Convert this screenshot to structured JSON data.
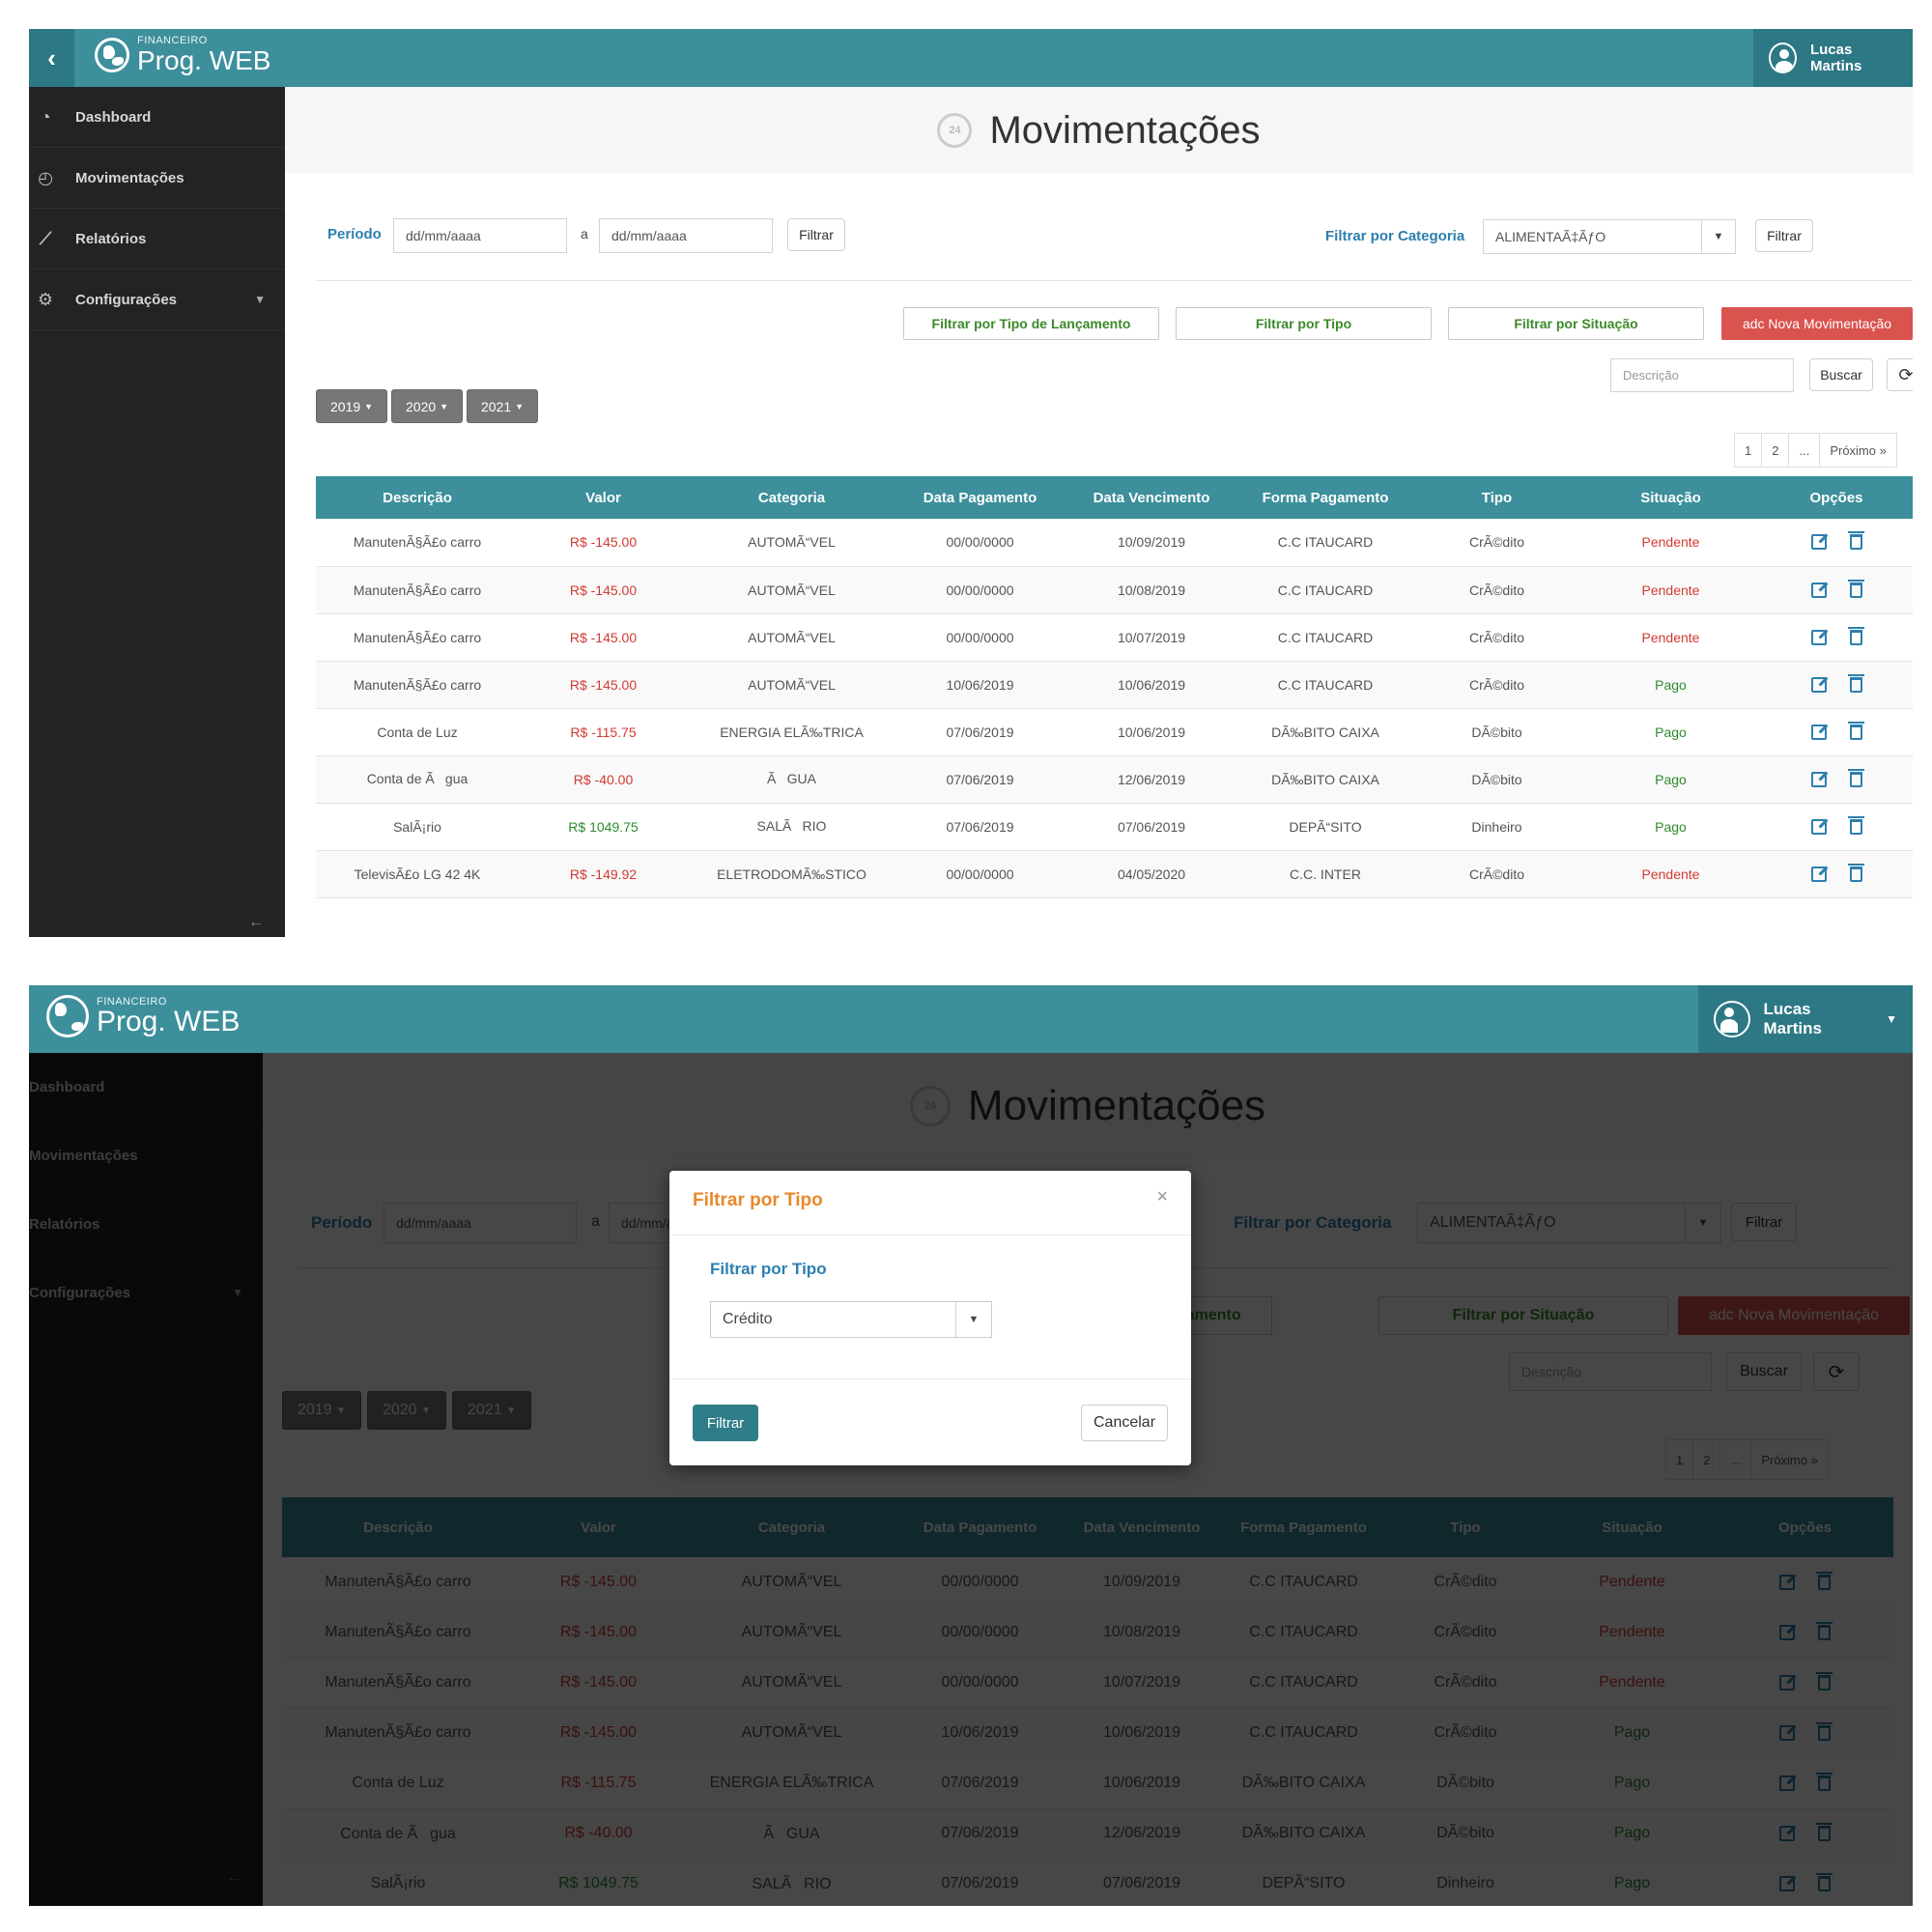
{
  "app": {
    "brand_small": "FINANCEIRO",
    "brand_name": "Prog. WEB",
    "user": "Lucas Martins"
  },
  "sidebar": {
    "items": [
      {
        "label": "Dashboard",
        "icon": "dashboard-icon"
      },
      {
        "label": "Movimentações",
        "icon": "clock-24-icon"
      },
      {
        "label": "Relatórios",
        "icon": "line-chart-icon"
      },
      {
        "label": "Configurações",
        "icon": "gear-icon"
      }
    ]
  },
  "page": {
    "title": "Movimentações",
    "clock_glyph": "24"
  },
  "filters": {
    "period_label": "Período",
    "date_placeholder": "dd/mm/aaaa",
    "date_sep": "a",
    "filter_btn": "Filtrar",
    "category_label": "Filtrar por Categoria",
    "category_value": "ALIMENTAÃ‡ÃƒO",
    "btn_tipo_lancamento": "Filtrar por Tipo de Lançamento",
    "btn_tipo": "Filtrar por Tipo",
    "btn_situacao": "Filtrar por Situação",
    "btn_nova": "adc Nova Movimentação",
    "search_placeholder": "Descrição",
    "search_btn": "Buscar",
    "years": [
      "2019",
      "2020",
      "2021"
    ]
  },
  "pagination": [
    "1",
    "2",
    "...",
    "Próximo »"
  ],
  "table": {
    "headers": [
      "Descrição",
      "Valor",
      "Categoria",
      "Data Pagamento",
      "Data Vencimento",
      "Forma Pagamento",
      "Tipo",
      "Situação",
      "Opções"
    ],
    "rows": [
      [
        "ManutenÃ§Ã£o carro",
        "R$ -145.00",
        "AUTOMÃ“VEL",
        "00/00/0000",
        "10/09/2019",
        "C.C ITAUCARD",
        "CrÃ©dito",
        "Pendente"
      ],
      [
        "ManutenÃ§Ã£o carro",
        "R$ -145.00",
        "AUTOMÃ“VEL",
        "00/00/0000",
        "10/08/2019",
        "C.C ITAUCARD",
        "CrÃ©dito",
        "Pendente"
      ],
      [
        "ManutenÃ§Ã£o carro",
        "R$ -145.00",
        "AUTOMÃ“VEL",
        "00/00/0000",
        "10/07/2019",
        "C.C ITAUCARD",
        "CrÃ©dito",
        "Pendente"
      ],
      [
        "ManutenÃ§Ã£o carro",
        "R$ -145.00",
        "AUTOMÃ“VEL",
        "10/06/2019",
        "10/06/2019",
        "C.C ITAUCARD",
        "CrÃ©dito",
        "Pago"
      ],
      [
        "Conta de Luz",
        "R$ -115.75",
        "ENERGIA ELÃ‰TRICA",
        "07/06/2019",
        "10/06/2019",
        "DÃ‰BITO CAIXA",
        "DÃ©bito",
        "Pago"
      ],
      [
        "Conta de Ãgua",
        "R$ -40.00",
        "ÃGUA",
        "07/06/2019",
        "12/06/2019",
        "DÃ‰BITO CAIXA",
        "DÃ©bito",
        "Pago"
      ],
      [
        "SalÃ¡rio",
        "R$ 1049.75",
        "SALÃRIO",
        "07/06/2019",
        "07/06/2019",
        "DEPÃ“SITO",
        "Dinheiro",
        "Pago"
      ],
      [
        "TelevisÃ£o LG 42 4K",
        "R$ -149.92",
        "ELETRODOMÃ‰STICO",
        "00/00/0000",
        "04/05/2020",
        "C.C. INTER",
        "CrÃ©dito",
        "Pendente"
      ]
    ]
  },
  "modal": {
    "title": "Filtrar por Tipo",
    "close_glyph": "×",
    "field_label": "Filtrar por Tipo",
    "select_value": "Crédito",
    "filter_btn": "Filtrar",
    "cancel_btn": "Cancelar"
  },
  "colors": {
    "teal": "#3c8f9b",
    "danger": "#d9534f",
    "link": "#2d7fae",
    "positive": "#2f8a2f",
    "modal_title": "#e8892a"
  }
}
